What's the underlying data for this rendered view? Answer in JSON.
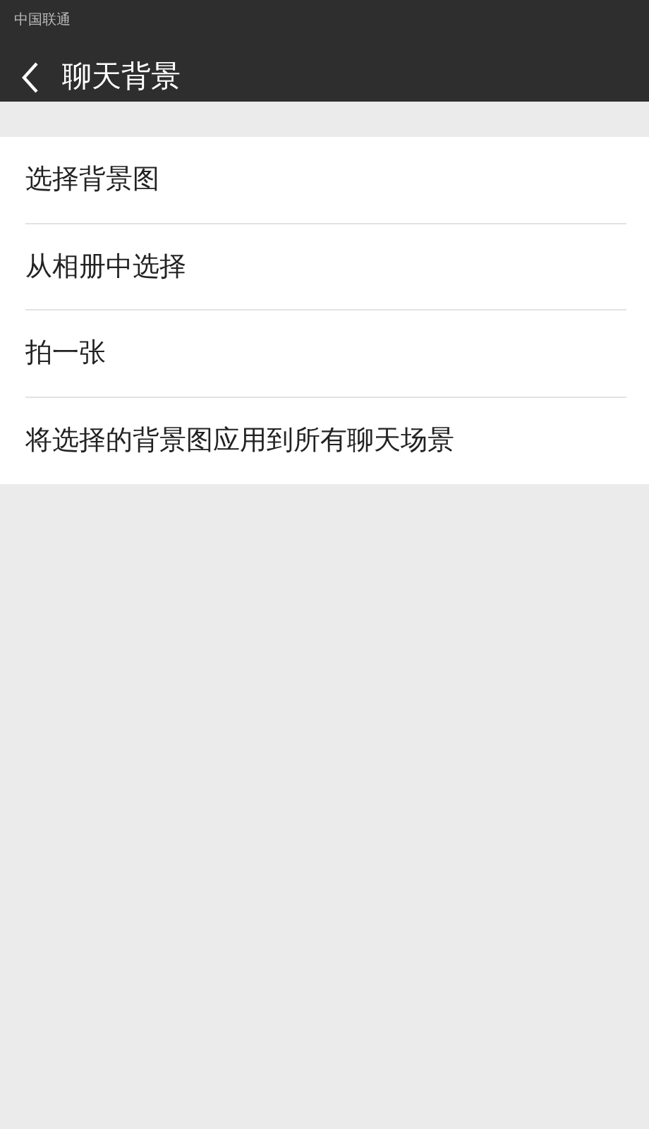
{
  "status_bar": {
    "carrier": "中国联通"
  },
  "header": {
    "title": "聊天背景"
  },
  "menu_items": [
    {
      "label": "选择背景图"
    },
    {
      "label": "从相册中选择"
    },
    {
      "label": "拍一张"
    },
    {
      "label": "将选择的背景图应用到所有聊天场景"
    }
  ]
}
